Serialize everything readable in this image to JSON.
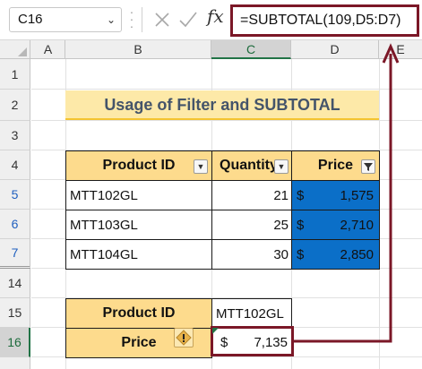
{
  "formula_bar": {
    "name_box": "C16",
    "fx_label": "fx",
    "formula": "=SUBTOTAL(109,D5:D7)"
  },
  "columns": [
    "A",
    "B",
    "C",
    "D",
    "E"
  ],
  "rows": [
    "1",
    "2",
    "3",
    "4",
    "5",
    "6",
    "7",
    "14",
    "15",
    "16"
  ],
  "title": "Usage of Filter and SUBTOTAL",
  "table": {
    "headers": [
      "Product ID",
      "Quantity",
      "Price"
    ],
    "rows": [
      {
        "id": "MTT102GL",
        "qty": "21",
        "currency": "$",
        "price": "1,575"
      },
      {
        "id": "MTT103GL",
        "qty": "25",
        "currency": "$",
        "price": "2,710"
      },
      {
        "id": "MTT104GL",
        "qty": "30",
        "currency": "$",
        "price": "2,850"
      }
    ]
  },
  "summary": {
    "product_label": "Product ID",
    "product_value": "MTT102GL",
    "price_label": "Price",
    "price_currency": "$",
    "price_value": "7,135"
  },
  "colors": {
    "accent": "#7b1727",
    "header_fill": "#fddb8d",
    "title_fill": "#fde9a8",
    "selection_fill": "#0b6fc8"
  }
}
